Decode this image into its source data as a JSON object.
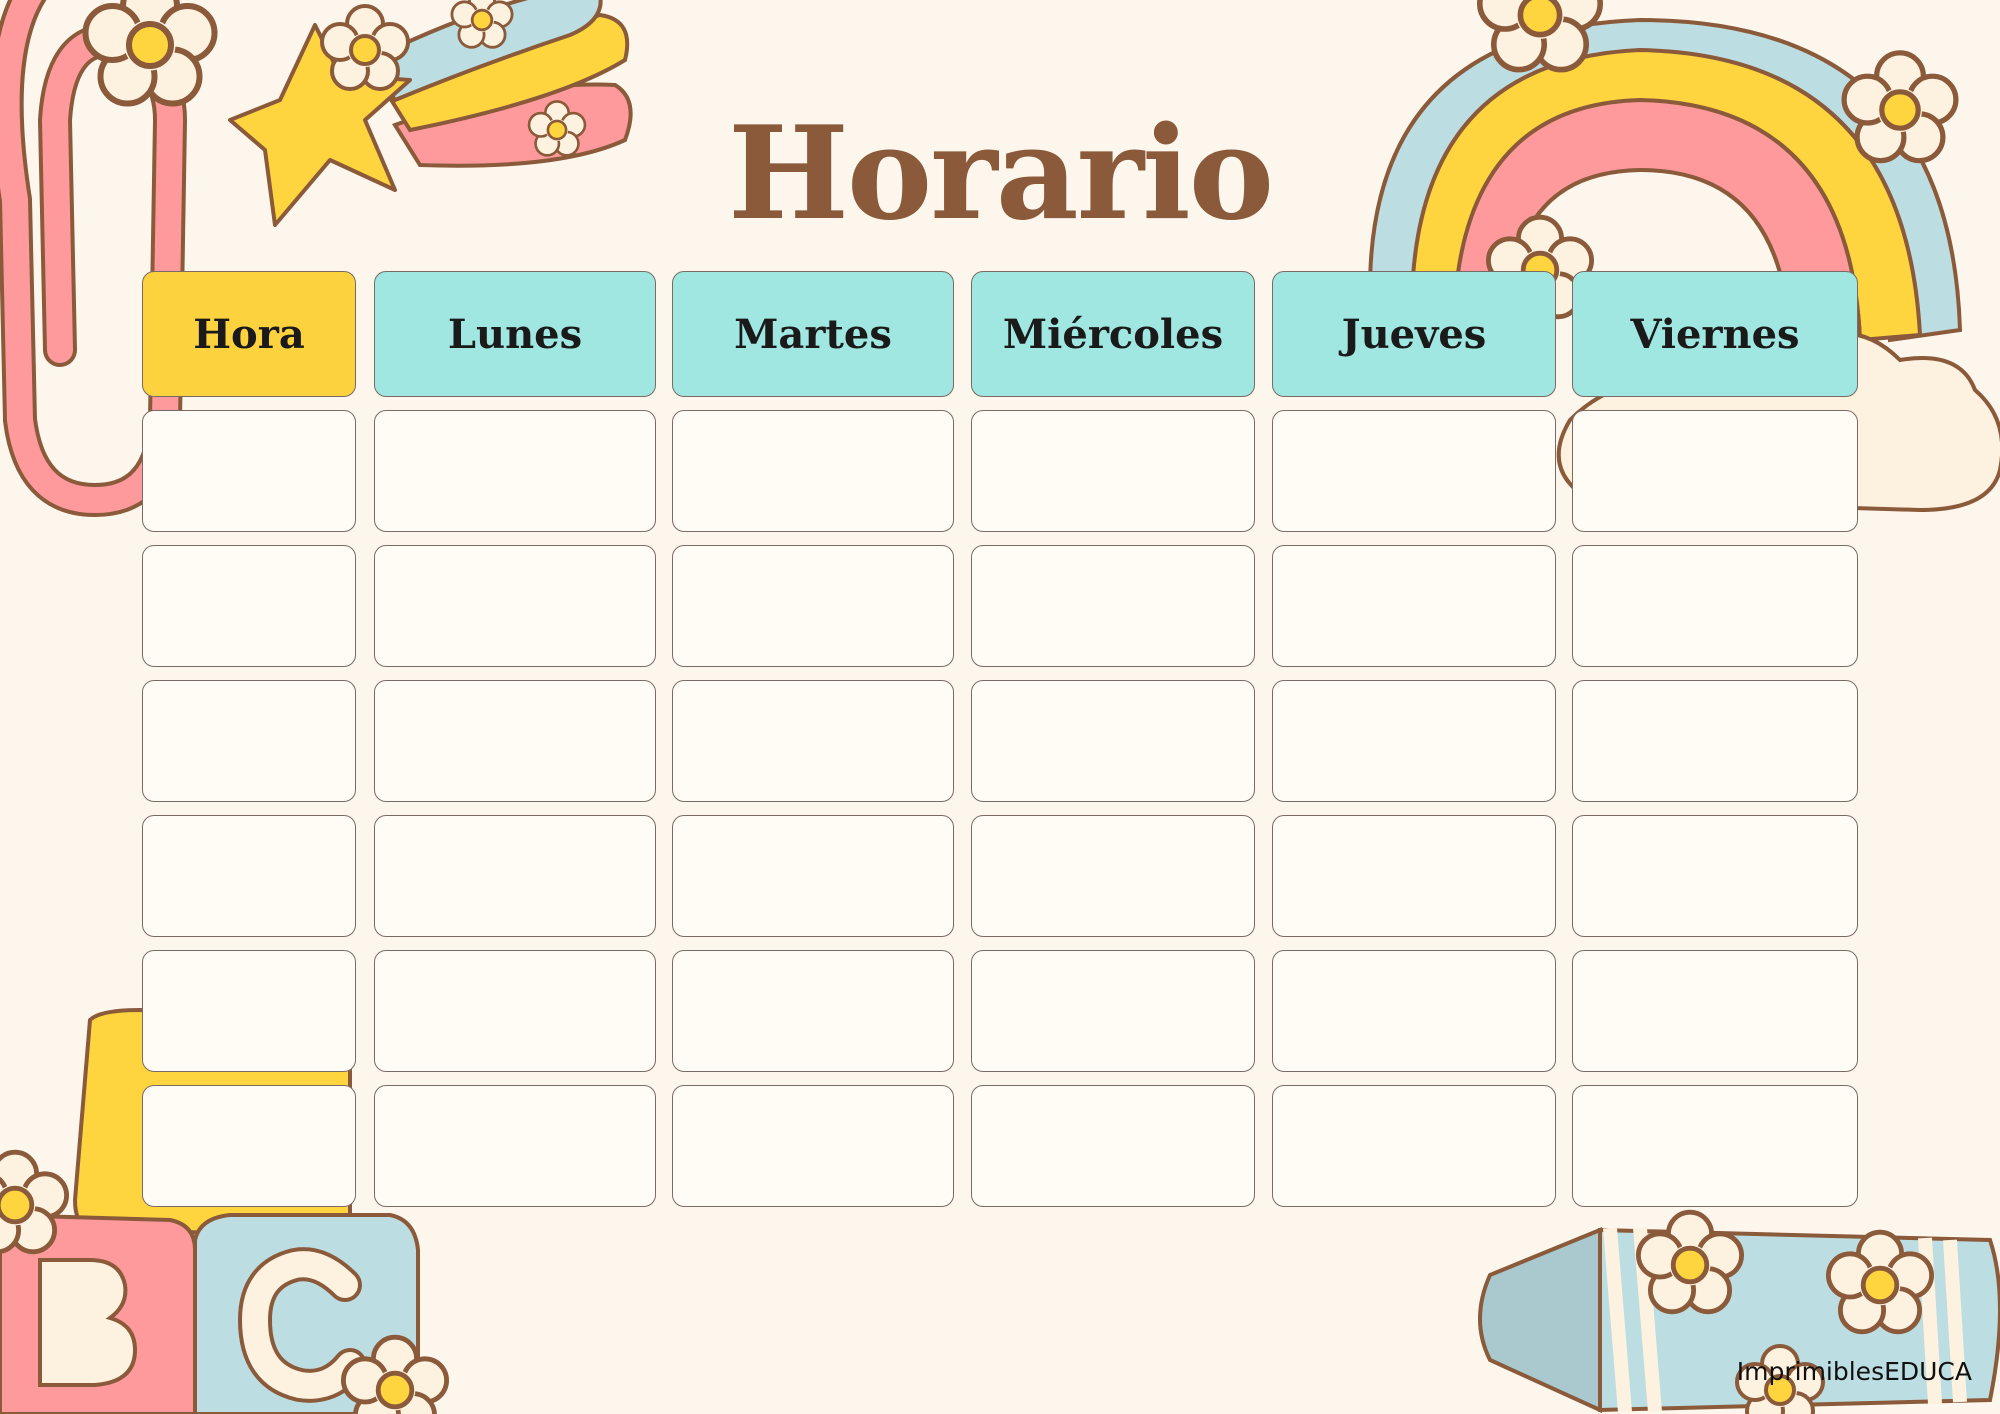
{
  "title": "Horario",
  "columns": [
    "Hora",
    "Lunes",
    "Martes",
    "Miércoles",
    "Jueves",
    "Viernes"
  ],
  "rows": 6,
  "credit": "ImprimiblesEDUCA",
  "colors": {
    "background": "#fdf6ec",
    "title": "#8a5a3a",
    "hora_header": "#fdd23f",
    "day_header": "#a0e6e1",
    "pink": "#fe9a9c",
    "yellow": "#fed53f",
    "blue": "#bcdde1",
    "cream": "#fdf1df",
    "outline": "#8a5a3a"
  },
  "decorations": [
    "rainbow-icon",
    "shooting-star-icon",
    "flower-icon",
    "paperclip-icon",
    "abc-blocks-icon",
    "crayon-icon",
    "cloud-icon"
  ]
}
